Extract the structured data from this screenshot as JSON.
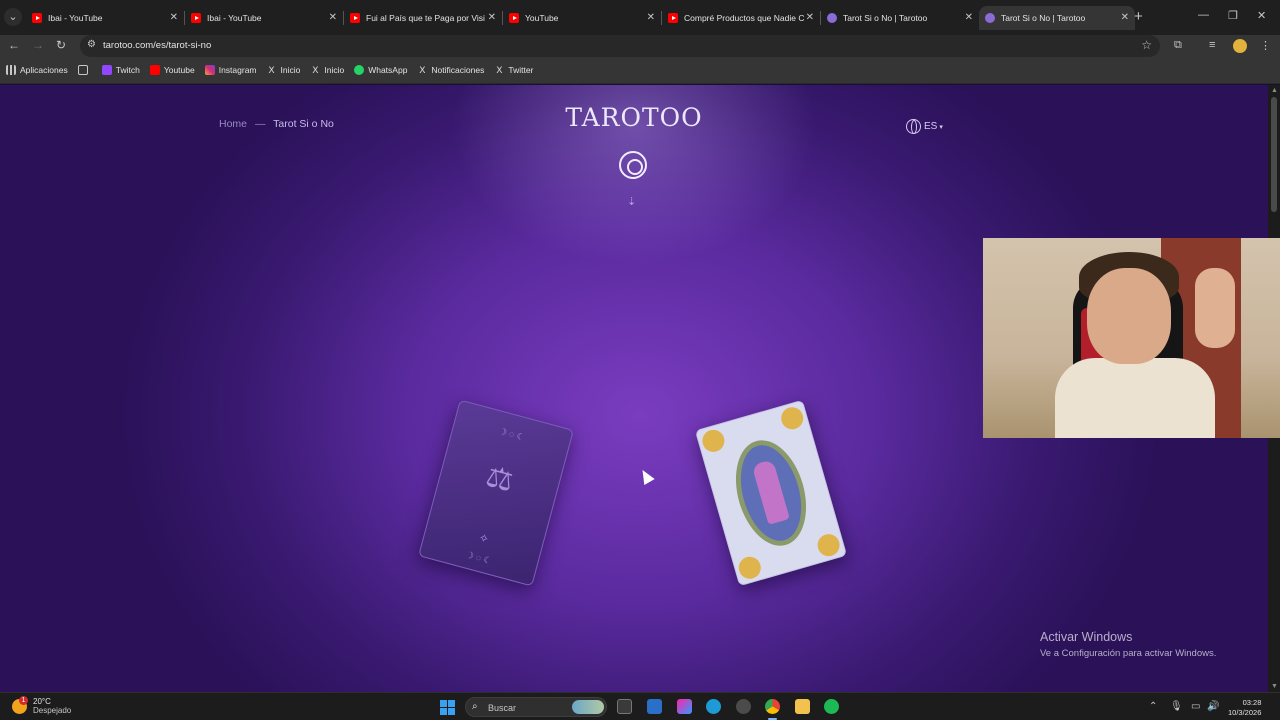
{
  "browser": {
    "tabs": [
      {
        "title": "Ibai - YouTube",
        "favicon": "youtube-icon",
        "active": false
      },
      {
        "title": "Ibai - YouTube",
        "favicon": "youtube-icon",
        "active": false
      },
      {
        "title": "Fui al País que te Paga por Visi",
        "favicon": "youtube-icon",
        "active": false
      },
      {
        "title": "YouTube",
        "favicon": "youtube-icon",
        "active": false
      },
      {
        "title": "Compré Productos que Nadie C",
        "favicon": "youtube-icon",
        "active": false
      },
      {
        "title": "Tarot Si o No | Tarotoo",
        "favicon": "tarotoo-icon",
        "active": false
      },
      {
        "title": "Tarot Si o No | Tarotoo",
        "favicon": "tarotoo-icon",
        "active": true
      }
    ],
    "url": "tarotoo.com/es/tarot-si-no",
    "bookmarks": [
      {
        "label": "Aplicaciones",
        "icon": "apps-icon"
      },
      {
        "label": "",
        "icon": "grid-icon"
      },
      {
        "label": "Twitch",
        "icon": "twitch-icon"
      },
      {
        "label": "Youtube",
        "icon": "youtube-icon"
      },
      {
        "label": "Instagram",
        "icon": "instagram-icon"
      },
      {
        "label": "Inicio",
        "icon": "x-icon"
      },
      {
        "label": "Inicio",
        "icon": "x-icon"
      },
      {
        "label": "WhatsApp",
        "icon": "whatsapp-icon"
      },
      {
        "label": "Notificaciones",
        "icon": "x-icon"
      },
      {
        "label": "Twitter",
        "icon": "x-icon"
      }
    ]
  },
  "page": {
    "breadcrumb": {
      "home": "Home",
      "separator": "—",
      "current": "Tarot Si o No"
    },
    "logo": "TAROTOO",
    "language": "ES",
    "cards": [
      {
        "name": "card-back",
        "face": "back"
      },
      {
        "name": "card-front",
        "face": "front"
      }
    ],
    "colors": {
      "background": "#5a2a9e",
      "accent": "#ede7fb"
    }
  },
  "watermark": {
    "title": "Activar Windows",
    "subtitle": "Ve a Configuración para activar Windows."
  },
  "taskbar": {
    "weather": {
      "temp": "20°C",
      "condition": "Despejado",
      "badge": "1"
    },
    "search_placeholder": "Buscar",
    "time": "03:28",
    "date": "10/3/2026"
  }
}
